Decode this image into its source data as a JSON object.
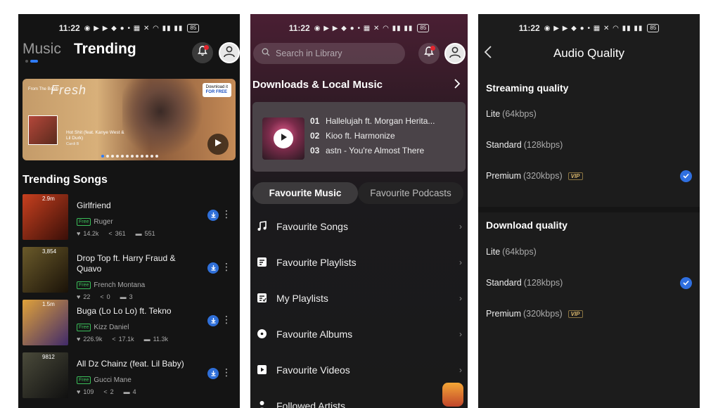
{
  "status": {
    "time": "11:22",
    "battery": "85"
  },
  "phone1": {
    "tabs": [
      "Music",
      "Trending"
    ],
    "banner": {
      "from_the_booth": "From The Booth",
      "fresh": "Fresh",
      "song": "Hot Shit (feat. Kanye West & Lil Durk)",
      "artist": "Cardi B",
      "badge_line1": "Download it",
      "badge_line2": "FOR FREE"
    },
    "section_title": "Trending Songs",
    "free_label": "Free",
    "songs": [
      {
        "title": "Girlfriend",
        "artist": "Ruger",
        "plays": "2.9m",
        "likes": "14.2k",
        "shares": "361",
        "comments": "551",
        "color_a": "#c7401f",
        "color_b": "#3a0f08"
      },
      {
        "title": "Drop Top ft. Harry Fraud & Quavo",
        "artist": "French Montana",
        "plays": "3,854",
        "likes": "22",
        "shares": "0",
        "comments": "3",
        "color_a": "#6a5a2a",
        "color_b": "#1a1208"
      },
      {
        "title": "Buga (Lo Lo Lo) ft. Tekno",
        "artist": "Kizz Daniel",
        "plays": "1.5m",
        "likes": "226.9k",
        "shares": "17.1k",
        "comments": "11.3k",
        "color_a": "#e0a23a",
        "color_b": "#402a6a"
      },
      {
        "title": "All Dz Chainz (feat. Lil Baby)",
        "artist": "Gucci Mane",
        "plays": "9812",
        "likes": "109",
        "shares": "2",
        "comments": "4",
        "color_a": "#4a4a3a",
        "color_b": "#101010"
      }
    ]
  },
  "phone2": {
    "search_placeholder": "Search in Library",
    "downloads_title": "Downloads & Local Music",
    "tracks": [
      {
        "num": "01",
        "name": "Hallelujah ft. Morgan Herita..."
      },
      {
        "num": "02",
        "name": "Kioo ft. Harmonize"
      },
      {
        "num": "03",
        "name": "astn - You're Almost There"
      }
    ],
    "fav_tabs": [
      "Favourite Music",
      "Favourite Podcasts"
    ],
    "fav_items": [
      "Favourite Songs",
      "Favourite Playlists",
      "My Playlists",
      "Favourite Albums",
      "Favourite Videos",
      "Followed Artists"
    ]
  },
  "phone3": {
    "title": "Audio Quality",
    "streaming_title": "Streaming quality",
    "download_title": "Download quality",
    "vip_label": "VIP",
    "streaming": [
      {
        "name": "Lite",
        "bitrate": "(64kbps)",
        "selected": false,
        "vip": false
      },
      {
        "name": "Standard",
        "bitrate": "(128kbps)",
        "selected": false,
        "vip": false
      },
      {
        "name": "Premium",
        "bitrate": "(320kbps)",
        "selected": true,
        "vip": true
      }
    ],
    "download": [
      {
        "name": "Lite",
        "bitrate": "(64kbps)",
        "selected": false,
        "vip": false
      },
      {
        "name": "Standard",
        "bitrate": "(128kbps)",
        "selected": true,
        "vip": false
      },
      {
        "name": "Premium",
        "bitrate": "(320kbps)",
        "selected": false,
        "vip": true
      }
    ],
    "accent": "#2f6fe0"
  }
}
